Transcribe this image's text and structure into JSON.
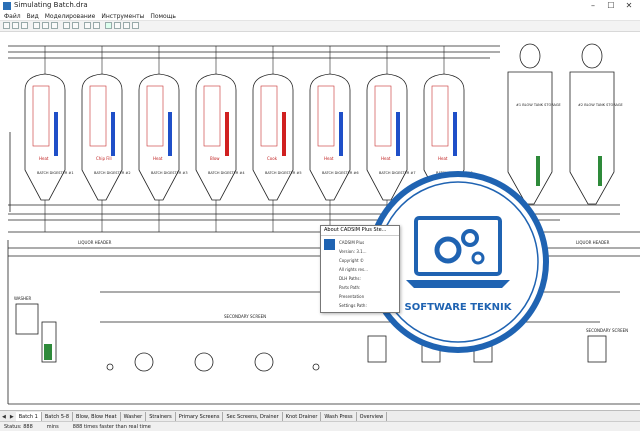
{
  "window": {
    "title": "Simulating Batch.dra",
    "min": "–",
    "max": "☐",
    "close": "✕"
  },
  "menu": [
    "Файл",
    "Вид",
    "Моделирование",
    "Инструменты",
    "Помощь"
  ],
  "tanks": [
    {
      "title": "BATCH DIGESTER #1",
      "label": "Heat"
    },
    {
      "title": "BATCH DIGESTER #2",
      "label": "Chip Fill"
    },
    {
      "title": "BATCH DIGESTER #3",
      "label": "Heat"
    },
    {
      "title": "BATCH DIGESTER #4",
      "label": "Blow"
    },
    {
      "title": "BATCH DIGESTER #5",
      "label": "Cook"
    },
    {
      "title": "BATCH DIGESTER #6",
      "label": "Heat"
    },
    {
      "title": "BATCH DIGESTER #7",
      "label": "Heat"
    },
    {
      "title": "BATCH DIGESTER #8",
      "label": "Heat"
    }
  ],
  "storage": [
    {
      "title": "#1 BLOW TANK STORAGE"
    },
    {
      "title": "#2 BLOW TANK STORAGE"
    }
  ],
  "lower_labels": {
    "header1": "LIQUOR HEADER",
    "header2": "LIQUOR HEADER",
    "washer": "WASHER",
    "screen_a": "SECONDARY SCREEN",
    "screen_b": "SECONDARY SCREEN"
  },
  "about": {
    "title": "About CADSIM Plus Ste...",
    "name": "CADSIM Plus",
    "version": "Version: 3.1...",
    "copyright": "Copyright ©",
    "rights": "All rights res...",
    "dll": "DLH Paths:",
    "parts": "Parts Path:",
    "presentation": "Presentation",
    "settings": "Settings Path:"
  },
  "watermark": {
    "text": "SOFTWARE TEKNIK",
    "color": "#1f63b2"
  },
  "tabs": [
    "Batch 1",
    "Batch 5-8",
    "Blow, Blow Heat",
    "Washer",
    "Strainers",
    "Primary Screens",
    "Sec Screens, Drainer",
    "Knot Drainer",
    "Wash Press",
    "Overview"
  ],
  "status": {
    "item1": "Status: 888",
    "item2": "mins",
    "item3": "888 times faster than real time"
  }
}
